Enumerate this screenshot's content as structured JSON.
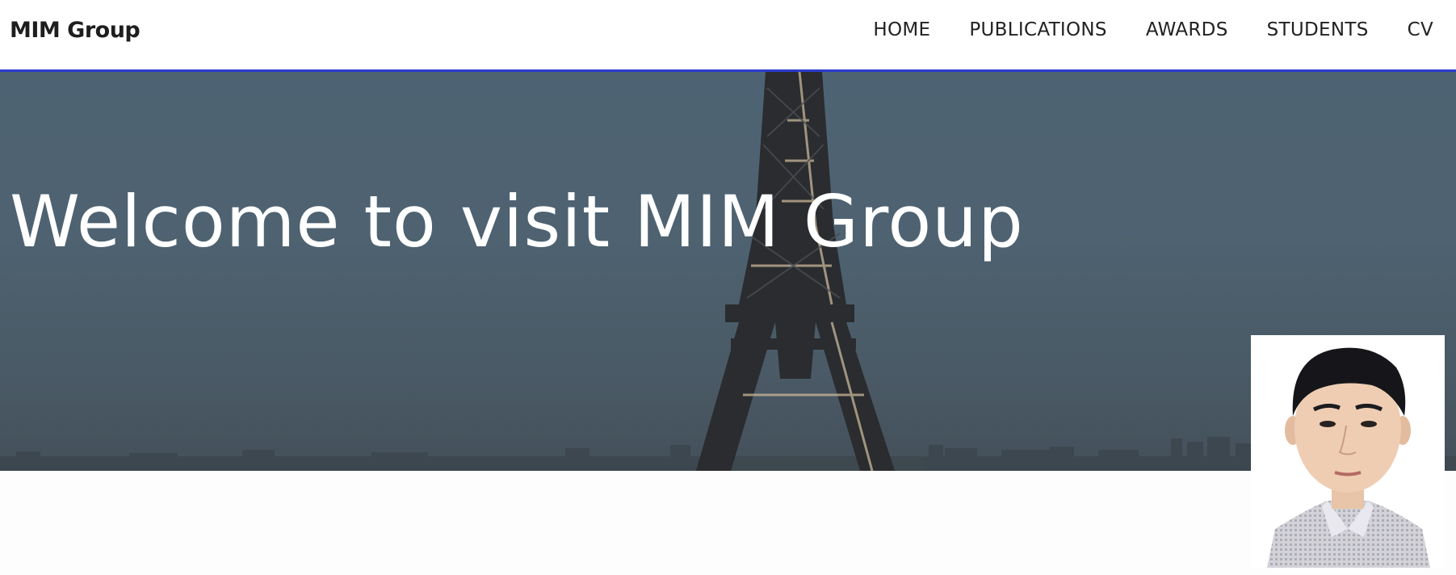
{
  "brand": {
    "name": "MIM Group"
  },
  "nav": {
    "items": [
      {
        "label": "HOME"
      },
      {
        "label": "PUBLICATIONS"
      },
      {
        "label": "AWARDS"
      },
      {
        "label": "STUDENTS"
      },
      {
        "label": "CV"
      }
    ]
  },
  "hero": {
    "title": "Welcome to visit MIM Group"
  },
  "colors": {
    "accent": "#2b3bd0",
    "hero_overlay": "#4d6373",
    "nav_text": "#222222"
  },
  "icons": {
    "hero_background": "eiffel-tower-image",
    "portrait": "profile-photo"
  }
}
